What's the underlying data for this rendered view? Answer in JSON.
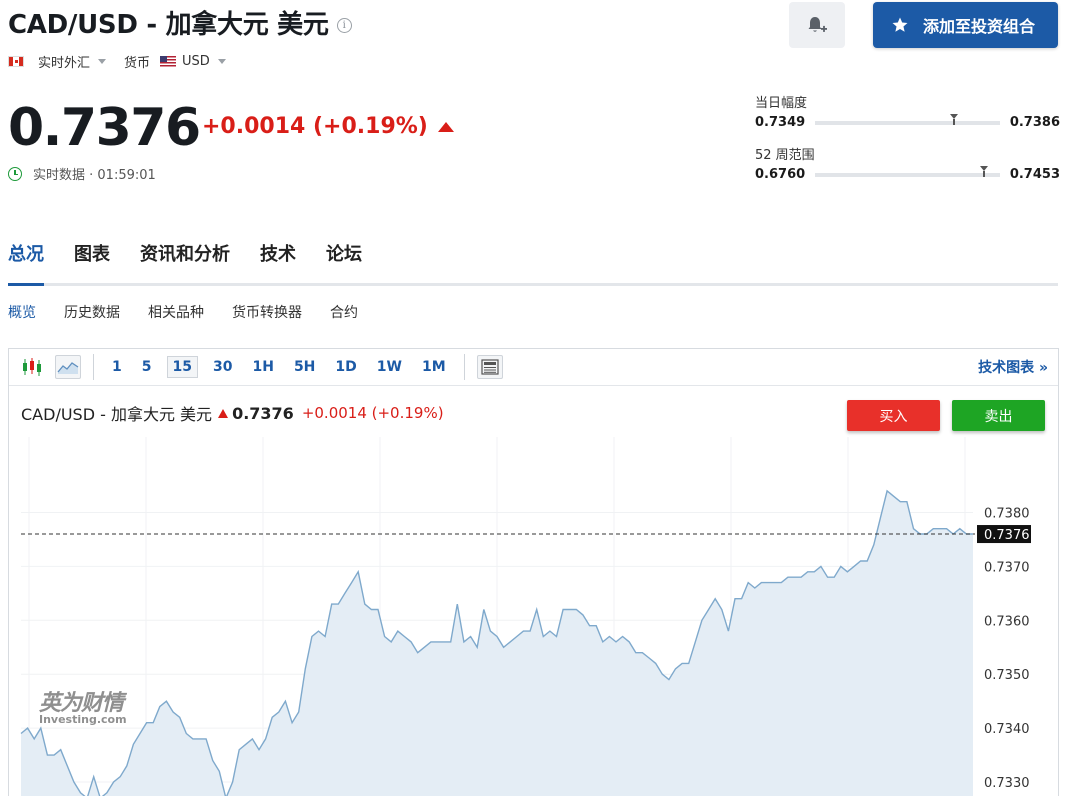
{
  "header": {
    "title": "CAD/USD - 加拿大元 美元",
    "info_icon": "i",
    "market_type": "实时外汇",
    "currency_label": "货币",
    "currency_value": "USD",
    "add_portfolio_label": "添加至投资组合"
  },
  "quote": {
    "price": "0.7376",
    "change": "+0.0014 (+0.19%)",
    "realtime_text": "实时数据 · 01:59:01"
  },
  "ranges": {
    "day": {
      "label": "当日幅度",
      "low": "0.7349",
      "high": "0.7386",
      "position": 0.73
    },
    "week52": {
      "label": "52 周范围",
      "low": "0.6760",
      "high": "0.7453",
      "position": 0.89
    }
  },
  "tabs": [
    "总况",
    "图表",
    "资讯和分析",
    "技术",
    "论坛"
  ],
  "subtabs": [
    "概览",
    "历史数据",
    "相关品种",
    "货币转换器",
    "合约"
  ],
  "toolbar": {
    "intervals": [
      "1",
      "5",
      "15",
      "30",
      "1H",
      "5H",
      "1D",
      "1W",
      "1M"
    ],
    "active_interval": "15",
    "tech_chart_link": "技术图表 »"
  },
  "chart_header": {
    "name": "CAD/USD - 加拿大元 美元",
    "price": "0.7376",
    "change": "+0.0014 (+0.19%)",
    "buy_label": "买入",
    "sell_label": "卖出"
  },
  "watermark": {
    "cn": "英为财情",
    "en": "Investing.com"
  },
  "colors": {
    "brand_blue": "#1c5aa6",
    "up_red": "#d91e18",
    "buy_red": "#e8302a",
    "sell_green": "#1ea524",
    "line": "#7fa9cc",
    "area": "#e4edf5"
  },
  "chart_data": {
    "type": "area",
    "y_ticks": [
      "0.7380",
      "0.7370",
      "0.7360",
      "0.7350",
      "0.7340",
      "0.7330"
    ],
    "y_range": [
      0.7325,
      0.7394
    ],
    "current_price_line": 0.7376,
    "current_price_label": "0.7376",
    "values": [
      0.7339,
      0.734,
      0.7338,
      0.734,
      0.7335,
      0.7335,
      0.7336,
      0.7333,
      0.733,
      0.7328,
      0.7327,
      0.7331,
      0.7327,
      0.7328,
      0.733,
      0.7331,
      0.7333,
      0.7337,
      0.7339,
      0.7341,
      0.7341,
      0.7344,
      0.7345,
      0.7343,
      0.7342,
      0.7339,
      0.7338,
      0.7338,
      0.7338,
      0.7334,
      0.7332,
      0.7327,
      0.733,
      0.7336,
      0.7337,
      0.7338,
      0.7336,
      0.7338,
      0.7342,
      0.7343,
      0.7345,
      0.7341,
      0.7343,
      0.7351,
      0.7357,
      0.7358,
      0.7357,
      0.7363,
      0.7363,
      0.7365,
      0.7367,
      0.7369,
      0.7363,
      0.7362,
      0.7362,
      0.7357,
      0.7356,
      0.7358,
      0.7357,
      0.7356,
      0.7354,
      0.7355,
      0.7356,
      0.7356,
      0.7356,
      0.7356,
      0.7363,
      0.7356,
      0.7357,
      0.7355,
      0.7362,
      0.7358,
      0.7357,
      0.7355,
      0.7356,
      0.7357,
      0.7358,
      0.7358,
      0.7362,
      0.7357,
      0.7358,
      0.7357,
      0.7362,
      0.7362,
      0.7362,
      0.7361,
      0.7359,
      0.7359,
      0.7356,
      0.7357,
      0.7356,
      0.7357,
      0.7356,
      0.7354,
      0.7354,
      0.7353,
      0.7352,
      0.735,
      0.7349,
      0.7351,
      0.7352,
      0.7352,
      0.7356,
      0.736,
      0.7362,
      0.7364,
      0.7362,
      0.7358,
      0.7364,
      0.7364,
      0.7367,
      0.7366,
      0.7367,
      0.7367,
      0.7367,
      0.7367,
      0.7368,
      0.7368,
      0.7368,
      0.7369,
      0.7369,
      0.737,
      0.7368,
      0.7368,
      0.737,
      0.7369,
      0.737,
      0.7371,
      0.7371,
      0.7374,
      0.7379,
      0.7384,
      0.7383,
      0.7382,
      0.7382,
      0.7377,
      0.7376,
      0.7376,
      0.7377,
      0.7377,
      0.7377,
      0.7376,
      0.7377,
      0.7376,
      0.7376
    ]
  }
}
